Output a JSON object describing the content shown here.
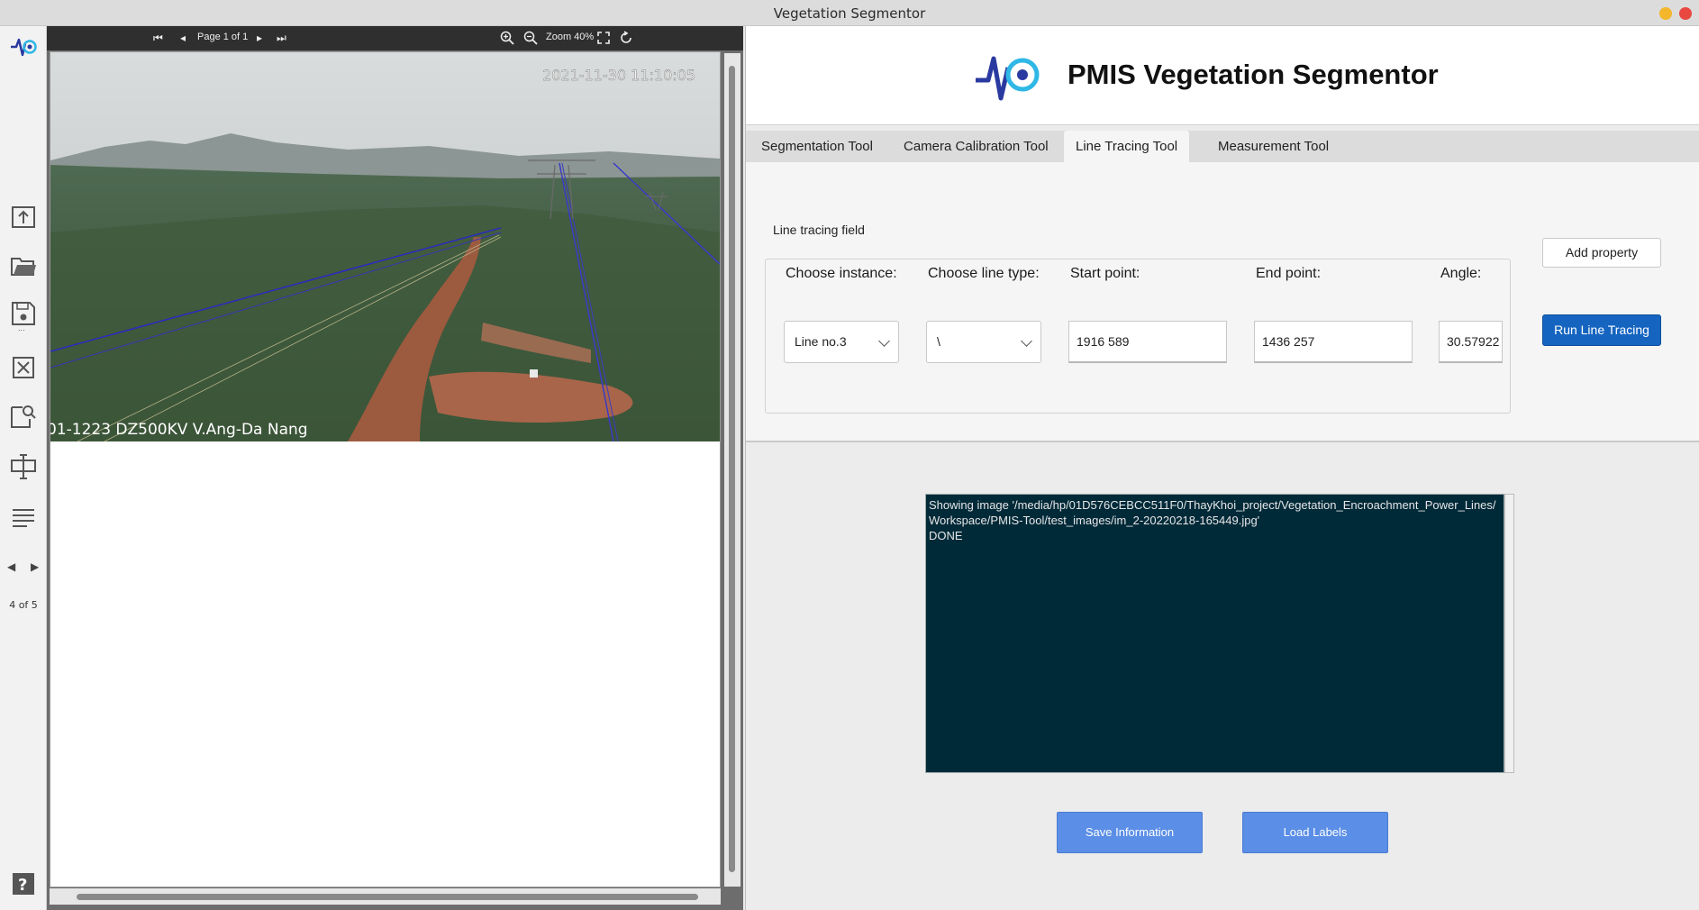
{
  "window": {
    "title": "Vegetation Segmentor"
  },
  "sidebar": {
    "page_indicator": "4 of 5",
    "icons": [
      "app-logo-icon",
      "upload-icon",
      "folder-open-icon",
      "save-icon",
      "close-box-icon",
      "search-document-icon",
      "text-cursor-icon",
      "list-lines-icon",
      "previous-arrow-icon",
      "next-arrow-icon",
      "help-icon"
    ]
  },
  "viewer": {
    "page_label": "Page 1 of 1",
    "zoom_label": "Zoom 40%",
    "photo_timestamp": "2021-11-30 11:10:05",
    "photo_caption": "01-1223 DZ500KV V.Ang-Da Nang"
  },
  "header": {
    "app_title": "PMIS Vegetation Segmentor"
  },
  "tabs": [
    {
      "label": "Segmentation Tool"
    },
    {
      "label": "Camera Calibration Tool"
    },
    {
      "label": "Line Tracing Tool"
    },
    {
      "label": "Measurement Tool"
    }
  ],
  "line_tracing": {
    "group_title": "Line tracing field",
    "labels": {
      "instance": "Choose instance:",
      "line_type": "Choose line type:",
      "start": "Start point:",
      "end": "End point:",
      "angle": "Angle:"
    },
    "values": {
      "instance": "Line no.3",
      "line_type": "\\",
      "start": "1916 589",
      "end": "1436 257",
      "angle": "30.57922"
    },
    "add_property": "Add property",
    "run": "Run Line Tracing"
  },
  "console": {
    "text": "Showing image '/media/hp/01D576CEBCC511F0/ThayKhoi_project/Vegetation_Encroachment_Power_Lines/Workspace/PMIS-Tool/test_images/im_2-20220218-165449.jpg'\nDONE"
  },
  "buttons": {
    "save": "Save Information",
    "load": "Load Labels"
  },
  "colors": {
    "primary": "#1565c0",
    "secondary_button": "#5b8ee6",
    "console_bg": "#012a39",
    "viewer_toolbar": "#2f2f2f"
  }
}
